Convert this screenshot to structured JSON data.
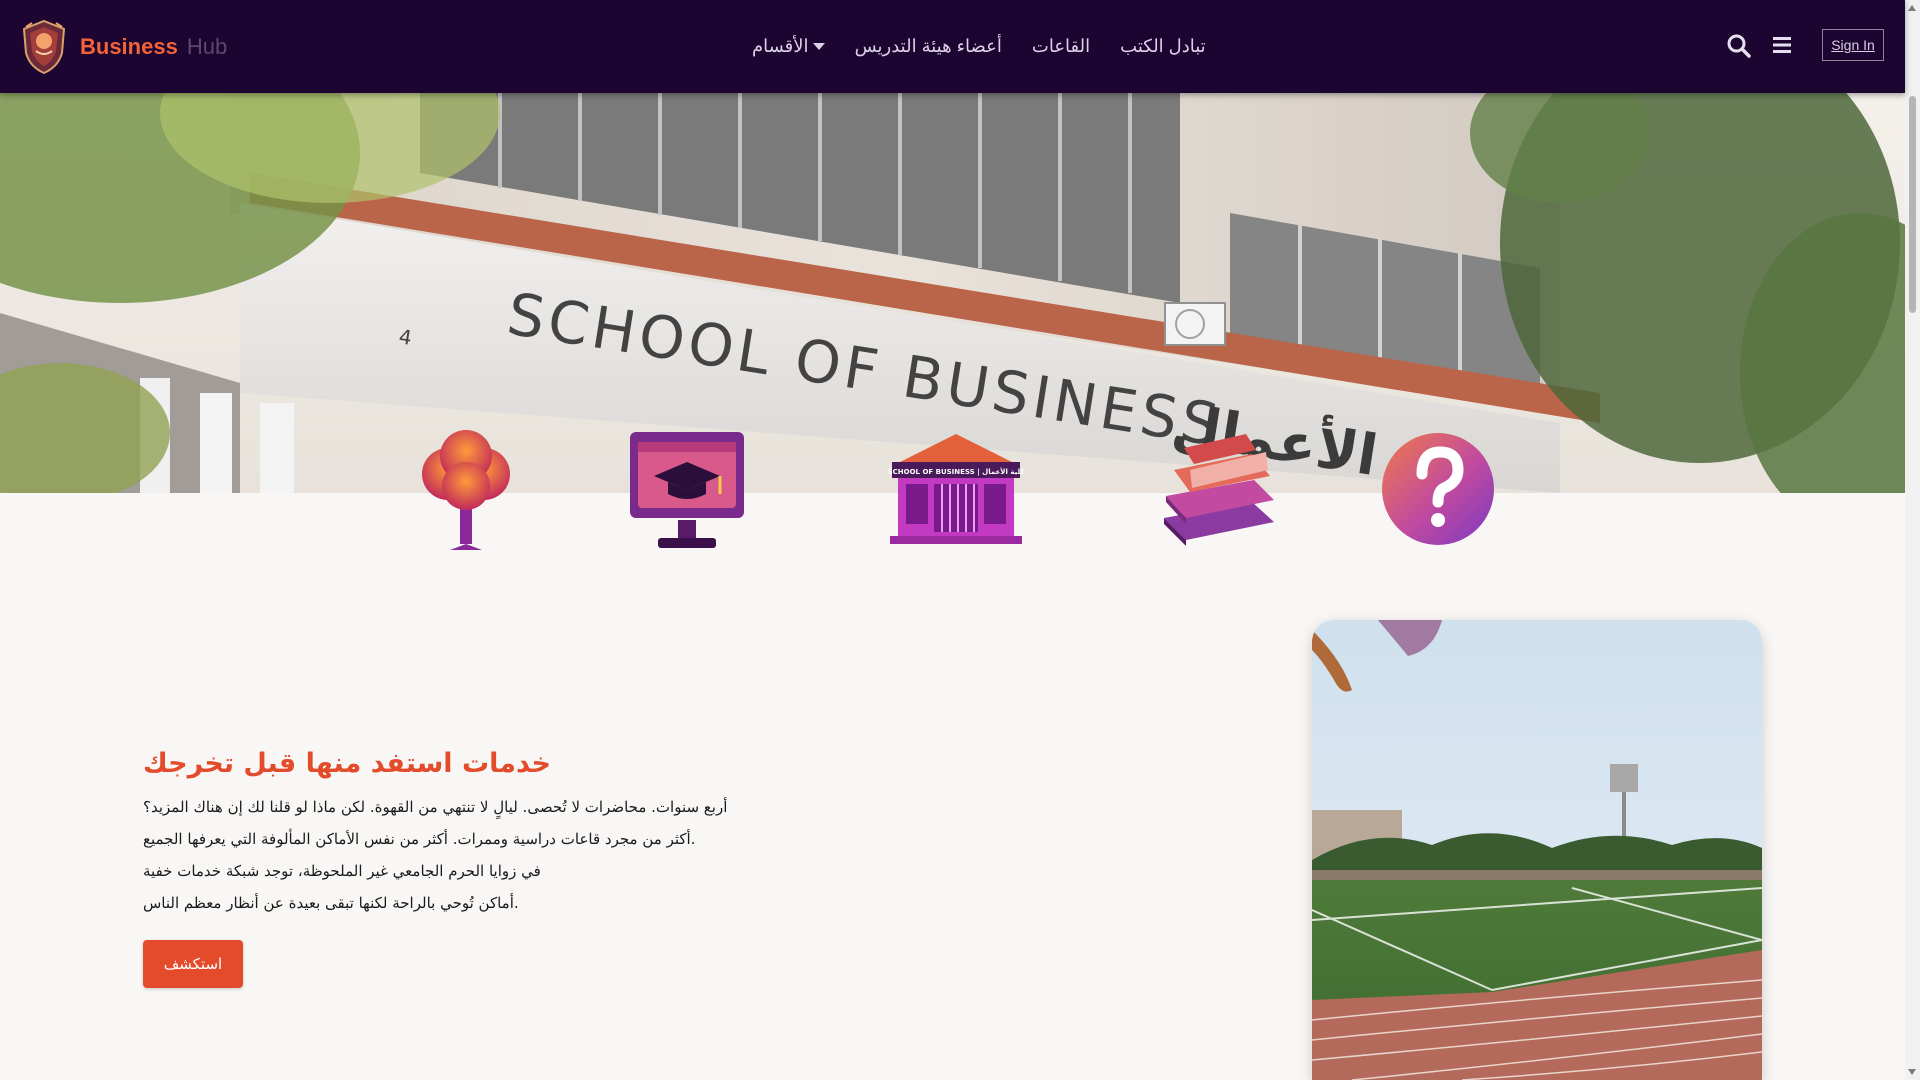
{
  "brand": {
    "name_primary": "Business",
    "name_secondary": "Hub",
    "logo_icon": "shield-logo-icon"
  },
  "nav": {
    "items": [
      {
        "label": "الأقسام",
        "has_dropdown": true
      },
      {
        "label": "أعضاء هيئة التدريس"
      },
      {
        "label": "القاعات"
      },
      {
        "label": "تبادل الكتب"
      }
    ],
    "search_icon": "search-icon",
    "menu_icon": "hamburger-menu-icon",
    "signin_label": "Sign In"
  },
  "hero": {
    "building_sign": "SCHOOL OF BUSINESS",
    "building_number": "4",
    "arabic_sign": "الأعمال"
  },
  "feature_icons": [
    {
      "icon": "tree-icon"
    },
    {
      "icon": "graduation-monitor-icon"
    },
    {
      "icon": "school-building-icon",
      "sign": "SCHOOL OF BUSINESS | كلية الأعمال"
    },
    {
      "icon": "books-stack-icon"
    },
    {
      "icon": "question-mark-icon"
    }
  ],
  "section": {
    "heading": "خدمات استفد منها قبل تخرجك",
    "lines": [
      "أربع سنوات. محاضرات لا تُحصى. ليالٍ لا تنتهي من القهوة. لكن ماذا لو قلنا لك إن هناك المزيد؟",
      ".أكثر من مجرد قاعات دراسية وممرات. أكثر من نفس الأماكن المألوفة التي يعرفها الجميع",
      "في زوايا الحرم الجامعي غير الملحوظة، توجد شبكة خدمات خفية",
      ".أماكن تُوحي بالراحة لكنها تبقى بعيدة عن أنظار معظم الناس"
    ],
    "button_label": "استكشف"
  },
  "colors": {
    "navbar_bg": "#1c0531",
    "accent": "#e34b2a",
    "page_bg": "#f9f7f5"
  }
}
